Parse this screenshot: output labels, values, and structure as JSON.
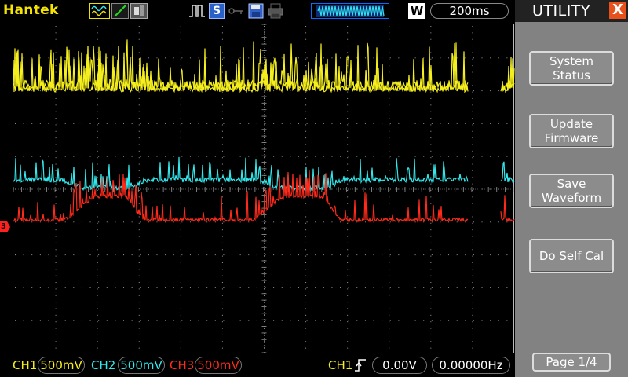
{
  "brand": "Hantek",
  "toolbar": {
    "icons": [
      "waveform-mode-icon",
      "line-display-icon",
      "persistence-icon",
      "pulse-icon",
      "s-icon",
      "key-icon",
      "save-icon",
      "print-icon",
      "memory-depth-icon"
    ],
    "s_label": "S",
    "w_label": "W",
    "timebase": "200ms"
  },
  "colors": {
    "ch1": "#f5ef1e",
    "ch2": "#33e8ec",
    "ch3": "#ff2a1a",
    "grid": "#9a9a9a",
    "panel": "#828282"
  },
  "screen": {
    "ch3_marker": "3"
  },
  "status": {
    "ch1_label": "CH1",
    "ch1_scale": "500mV",
    "ch2_label": "CH2",
    "ch2_scale": "500mV",
    "ch3_label": "CH3",
    "ch3_scale": "500mV",
    "trigger_source": "CH1",
    "trigger_level": "0.00V",
    "trigger_freq": "0.00000Hz"
  },
  "panel": {
    "title": "UTILITY",
    "close": "X",
    "buttons": [
      {
        "line1": "System",
        "line2": "Status"
      },
      {
        "line1": "Update",
        "line2": "Firmware"
      },
      {
        "line1": "Save",
        "line2": "Waveform"
      },
      {
        "line1": "Do Self Cal",
        "line2": ""
      }
    ],
    "page": "Page 1/4"
  }
}
